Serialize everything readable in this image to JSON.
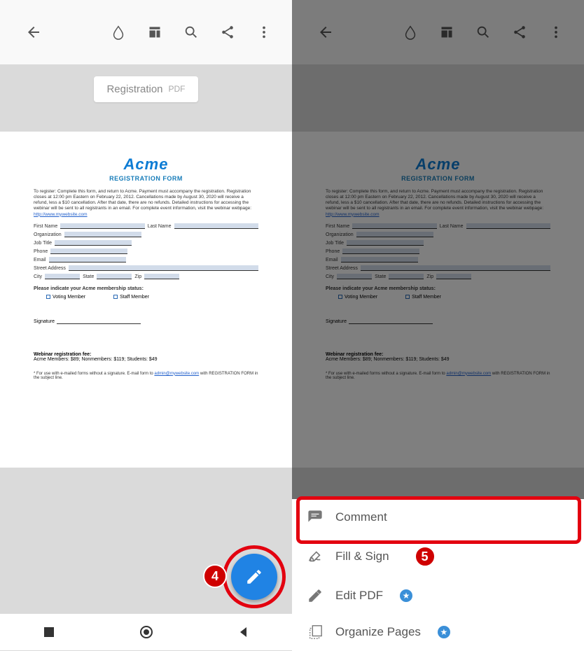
{
  "document": {
    "badge_title": "Registration",
    "badge_type": "PDF",
    "logo": "Acme",
    "form_title": "REGISTRATION FORM",
    "instructions": "To register: Complete this form, and return to Acme. Payment must accompany the registration. Registration closes at 12:00 pm Eastern on February 22, 2012. Cancellations made by August 30, 2020 will receive a refund, less a $10 cancellation. After that date, there are no refunds. Detailed instructions for accessing the webinar will be sent to all registrants in an email. For complete event information, visit the webinar webpage: ",
    "instructions_link": "http://www.mywebsite.com",
    "labels": {
      "first_name": "First Name",
      "last_name": "Last Name",
      "organization": "Organization",
      "job_title": "Job Title",
      "phone": "Phone",
      "email": "Email",
      "street": "Street Address",
      "city": "City",
      "state": "State",
      "zip": "Zip"
    },
    "membership_prompt": "Please indicate your Acme membership status:",
    "voting_member": "Voting Member",
    "staff_member": "Staff Member",
    "signature": "Signature",
    "webinar_fee": "Webinar registration fee:",
    "fee_details": "Acme Members: $89; Nonmembers: $119; Students: $49",
    "footnote_prefix": "* For use with e-mailed forms without a signature. E-mail form to ",
    "footnote_link": "admin@mywebsite.com",
    "footnote_suffix": " with REGISTRATION FORM in the subject line."
  },
  "actions": {
    "comment": "Comment",
    "fillsign": "Fill & Sign",
    "editpdf": "Edit PDF",
    "organize": "Organize Pages"
  },
  "annotations": {
    "n4": "4",
    "n5": "5"
  }
}
